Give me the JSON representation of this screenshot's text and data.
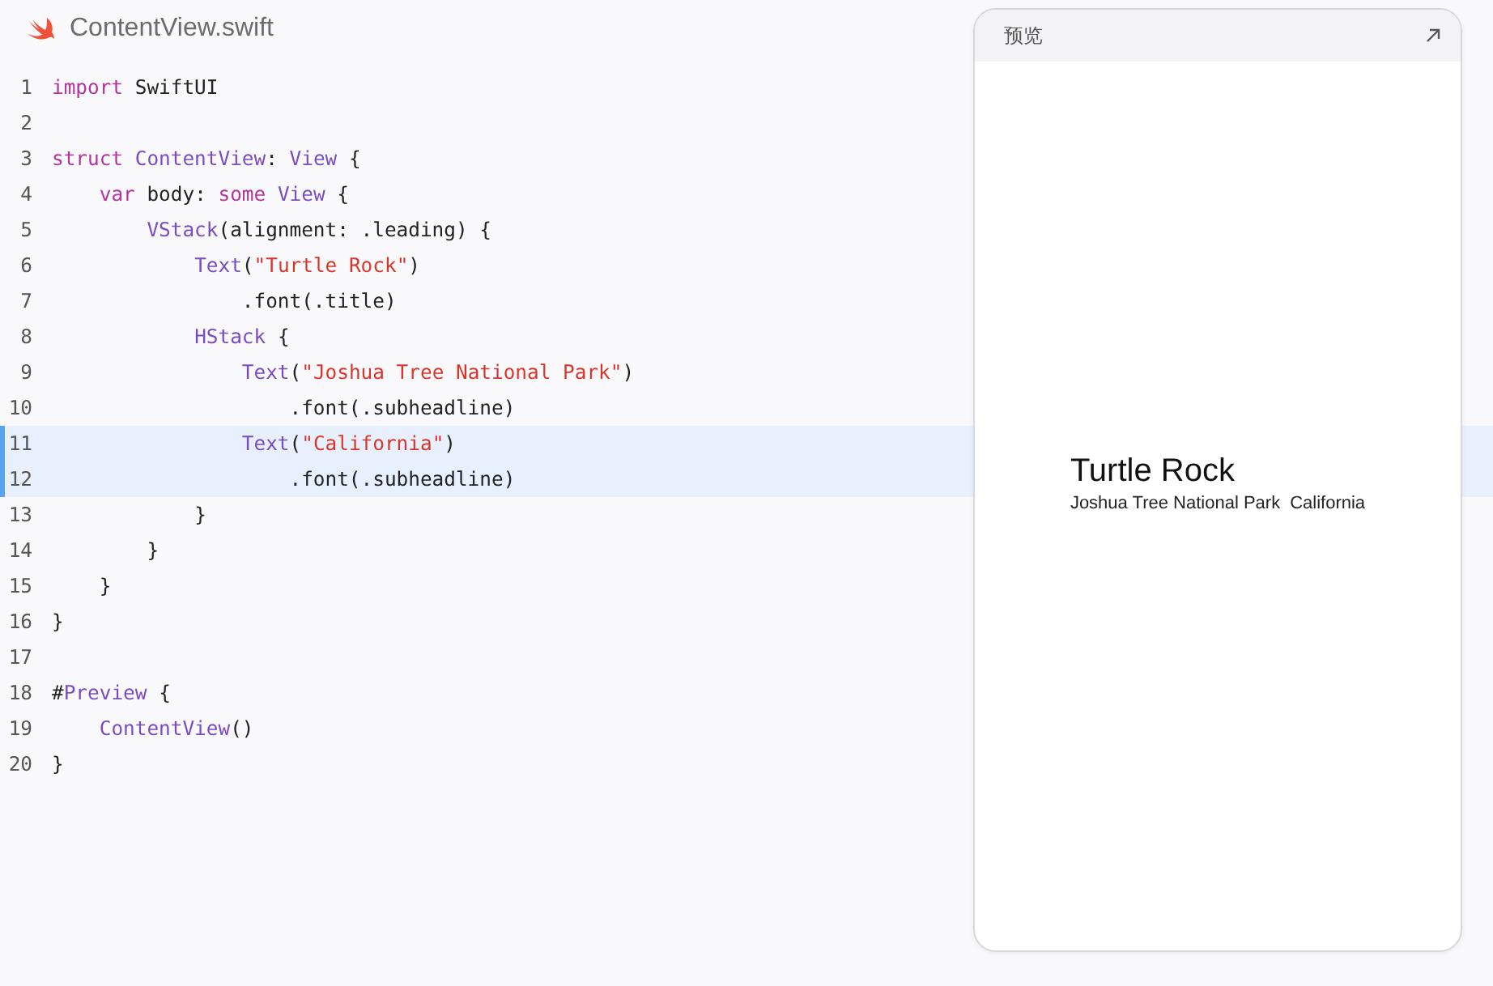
{
  "file_tab": {
    "title": "ContentView.swift"
  },
  "code_lines": [
    {
      "number": "1",
      "highlighted": false,
      "tokens": [
        {
          "kind": "keyword",
          "text": "import"
        },
        {
          "kind": "plain",
          "text": " SwiftUI"
        }
      ]
    },
    {
      "number": "2",
      "highlighted": false
    },
    {
      "number": "3",
      "highlighted": false,
      "tokens": [
        {
          "kind": "keyword",
          "text": "struct "
        },
        {
          "kind": "type",
          "text": "ContentView"
        },
        {
          "kind": "plain",
          "text": ": "
        },
        {
          "kind": "type",
          "text": "View"
        },
        {
          "kind": "plain",
          "text": " {"
        }
      ]
    },
    {
      "number": "4",
      "highlighted": false,
      "tokens": [
        {
          "kind": "keyword",
          "text": "    var"
        },
        {
          "kind": "plain",
          "text": " body: "
        },
        {
          "kind": "keyword",
          "text": "some "
        },
        {
          "kind": "type",
          "text": "View"
        },
        {
          "kind": "plain",
          "text": " {"
        }
      ]
    },
    {
      "number": "5",
      "highlighted": false,
      "tokens": [
        {
          "kind": "type",
          "text": "        VStack"
        },
        {
          "kind": "plain",
          "text": "(alignment: .leading) {"
        }
      ]
    },
    {
      "number": "6",
      "highlighted": false,
      "tokens": [
        {
          "kind": "type",
          "text": "            Text"
        },
        {
          "kind": "plain",
          "text": "("
        },
        {
          "kind": "string",
          "text": "\"Turtle Rock\""
        },
        {
          "kind": "plain",
          "text": ")"
        }
      ]
    },
    {
      "number": "7",
      "highlighted": false,
      "tokens": [
        {
          "kind": "plain",
          "text": "                .font(.title)"
        }
      ]
    },
    {
      "number": "8",
      "highlighted": false,
      "tokens": [
        {
          "kind": "type",
          "text": "            HStack"
        },
        {
          "kind": "plain",
          "text": " {"
        }
      ]
    },
    {
      "number": "9",
      "highlighted": false,
      "tokens": [
        {
          "kind": "type",
          "text": "                Text"
        },
        {
          "kind": "plain",
          "text": "("
        },
        {
          "kind": "string",
          "text": "\"Joshua Tree National Park\""
        },
        {
          "kind": "plain",
          "text": ")"
        }
      ]
    },
    {
      "number": "10",
      "highlighted": false,
      "tokens": [
        {
          "kind": "plain",
          "text": "                    .font(.subheadline)"
        }
      ]
    },
    {
      "number": "11",
      "highlighted": true,
      "tokens": [
        {
          "kind": "type",
          "text": "                Text"
        },
        {
          "kind": "plain",
          "text": "("
        },
        {
          "kind": "string",
          "text": "\"California\""
        },
        {
          "kind": "plain",
          "text": ")"
        }
      ]
    },
    {
      "number": "12",
      "highlighted": true,
      "tokens": [
        {
          "kind": "plain",
          "text": "                    .font(.subheadline)"
        }
      ]
    },
    {
      "number": "13",
      "highlighted": false,
      "tokens": [
        {
          "kind": "plain",
          "text": "            }"
        }
      ]
    },
    {
      "number": "14",
      "highlighted": false,
      "tokens": [
        {
          "kind": "plain",
          "text": "        }"
        }
      ]
    },
    {
      "number": "15",
      "highlighted": false,
      "tokens": [
        {
          "kind": "plain",
          "text": "    }"
        }
      ]
    },
    {
      "number": "16",
      "highlighted": false,
      "tokens": [
        {
          "kind": "plain",
          "text": "}"
        }
      ]
    },
    {
      "number": "17",
      "highlighted": false
    },
    {
      "number": "18",
      "highlighted": false,
      "tokens": [
        {
          "kind": "plain",
          "text": "#"
        },
        {
          "kind": "type",
          "text": "Preview"
        },
        {
          "kind": "plain",
          "text": " {"
        }
      ]
    },
    {
      "number": "19",
      "highlighted": false,
      "tokens": [
        {
          "kind": "type",
          "text": "    ContentView"
        },
        {
          "kind": "plain",
          "text": "()"
        }
      ]
    },
    {
      "number": "20",
      "highlighted": false,
      "tokens": [
        {
          "kind": "plain",
          "text": "}"
        }
      ]
    }
  ],
  "preview": {
    "title": "预览",
    "content": {
      "title": "Turtle Rock",
      "subtitles": [
        "Joshua Tree National Park",
        "California"
      ]
    }
  }
}
